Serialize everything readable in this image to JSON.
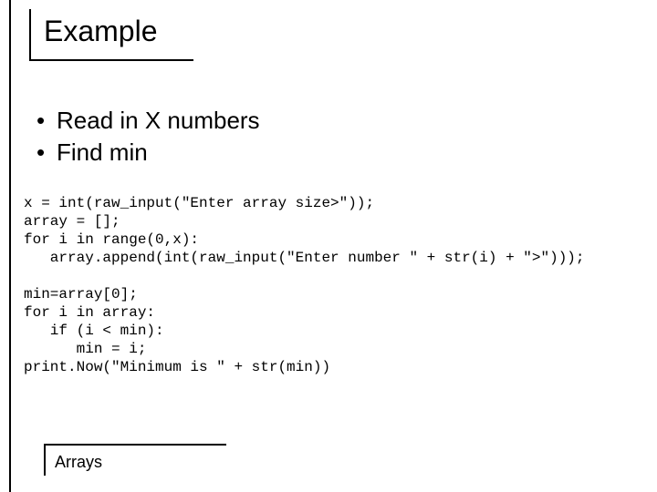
{
  "title": "Example",
  "bullets": [
    "Read in X numbers",
    "Find min"
  ],
  "code1": "x = int(raw_input(\"Enter array size>\"));\narray = [];\nfor i in range(0,x):\n   array.append(int(raw_input(\"Enter number \" + str(i) + \">\")));",
  "code2": "min=array[0];\nfor i in array:\n   if (i < min):\n      min = i;\nprint.Now(\"Minimum is \" + str(min))",
  "footer": "Arrays",
  "bullet_char": "•"
}
